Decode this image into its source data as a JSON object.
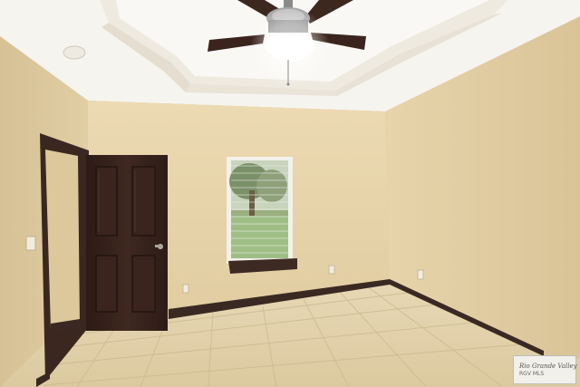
{
  "watermark": {
    "line1": "Rio Grande Valley",
    "line2": "RGV MLS"
  },
  "colors": {
    "left_wall": "#ddc99e",
    "back_wall": "#e6d2a8",
    "right_wall": "#e3cfa3",
    "ceiling": "#f4f1ea",
    "floor": "#e2d2ac",
    "trim": "#3b2a22",
    "door": "#35221c"
  },
  "icons": [
    "ceiling-fan-icon",
    "palm-tree-icon"
  ]
}
